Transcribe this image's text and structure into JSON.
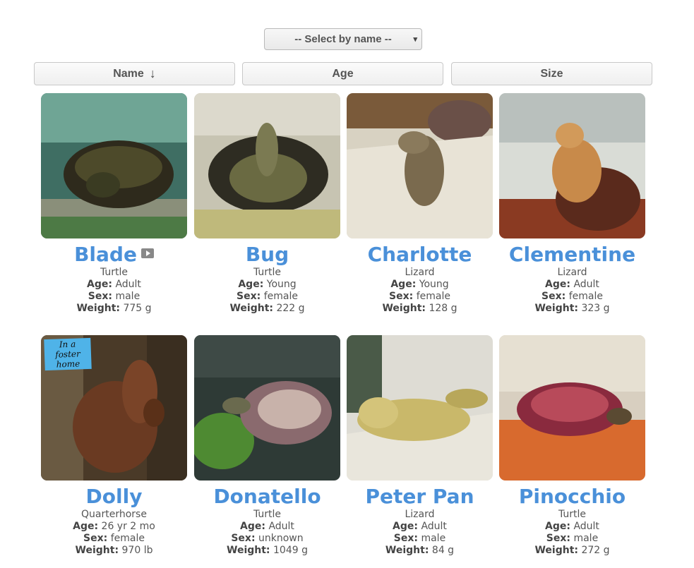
{
  "select": {
    "label": "-- Select by name --"
  },
  "sort": {
    "name_label": "Name",
    "age_label": "Age",
    "size_label": "Size",
    "name_arrow": "↓"
  },
  "labels": {
    "age": "Age:",
    "sex": "Sex:",
    "weight": "Weight:"
  },
  "foster_badge": "In a foster home",
  "animals": [
    {
      "name": "Blade",
      "species": "Turtle",
      "age": "Adult",
      "sex": "male",
      "weight": "775 g",
      "has_video": true
    },
    {
      "name": "Bug",
      "species": "Turtle",
      "age": "Young",
      "sex": "female",
      "weight": "222 g"
    },
    {
      "name": "Charlotte",
      "species": "Lizard",
      "age": "Young",
      "sex": "female",
      "weight": "128 g"
    },
    {
      "name": "Clementine",
      "species": "Lizard",
      "age": "Adult",
      "sex": "female",
      "weight": "323 g"
    },
    {
      "name": "Dolly",
      "species": "Quarterhorse",
      "age": "26 yr 2 mo",
      "sex": "female",
      "weight": "970 lb",
      "in_foster": true
    },
    {
      "name": "Donatello",
      "species": "Turtle",
      "age": "Adult",
      "sex": "unknown",
      "weight": "1049 g"
    },
    {
      "name": "Peter Pan",
      "species": "Lizard",
      "age": "Adult",
      "sex": "male",
      "weight": "84 g"
    },
    {
      "name": "Pinocchio",
      "species": "Turtle",
      "age": "Adult",
      "sex": "male",
      "weight": "272 g"
    }
  ]
}
